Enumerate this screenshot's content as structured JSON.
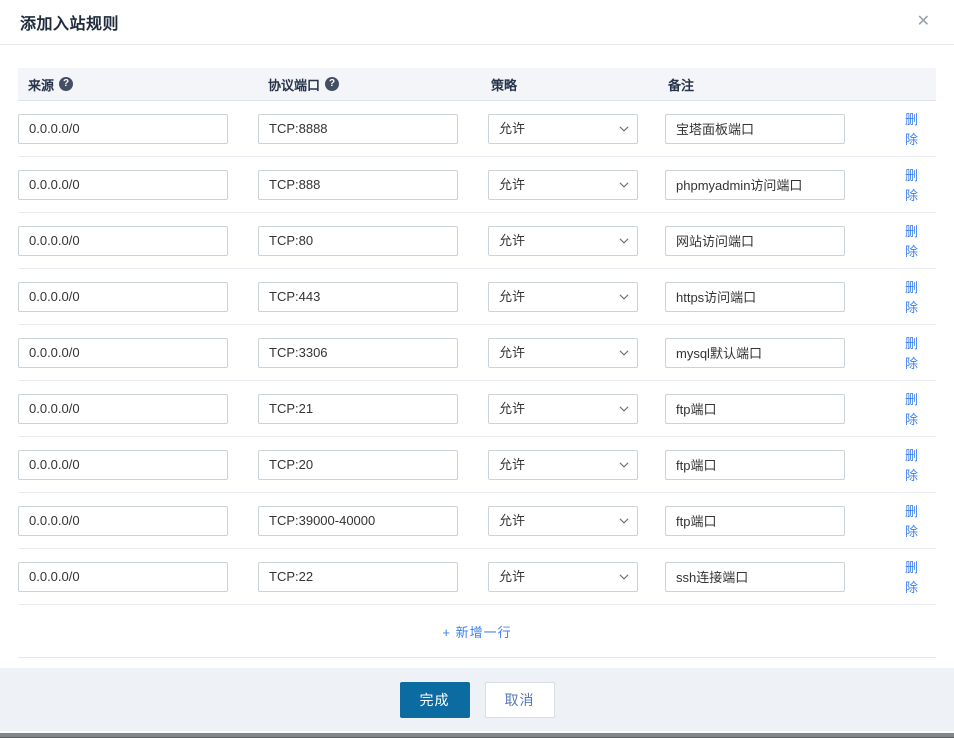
{
  "dialog": {
    "title": "添加入站规则",
    "close_glyph": "✕"
  },
  "icons": {
    "help_glyph": "?"
  },
  "table": {
    "headers": [
      {
        "label": "来源",
        "help": true
      },
      {
        "label": "协议端口",
        "help": true
      },
      {
        "label": "策略",
        "help": false
      },
      {
        "label": "备注",
        "help": false
      }
    ],
    "rows": [
      {
        "source": "0.0.0.0/0",
        "protocol": "TCP:8888",
        "policy": "允许",
        "remark": "宝塔面板端口",
        "action": "删除"
      },
      {
        "source": "0.0.0.0/0",
        "protocol": "TCP:888",
        "policy": "允许",
        "remark": "phpmyadmin访问端口",
        "action": "删除"
      },
      {
        "source": "0.0.0.0/0",
        "protocol": "TCP:80",
        "policy": "允许",
        "remark": "网站访问端口",
        "action": "删除"
      },
      {
        "source": "0.0.0.0/0",
        "protocol": "TCP:443",
        "policy": "允许",
        "remark": "https访问端口",
        "action": "删除"
      },
      {
        "source": "0.0.0.0/0",
        "protocol": "TCP:3306",
        "policy": "允许",
        "remark": "mysql默认端口",
        "action": "删除"
      },
      {
        "source": "0.0.0.0/0",
        "protocol": "TCP:21",
        "policy": "允许",
        "remark": "ftp端口",
        "action": "删除"
      },
      {
        "source": "0.0.0.0/0",
        "protocol": "TCP:20",
        "policy": "允许",
        "remark": "ftp端口",
        "action": "删除"
      },
      {
        "source": "0.0.0.0/0",
        "protocol": "TCP:39000-40000",
        "policy": "允许",
        "remark": "ftp端口",
        "action": "删除"
      },
      {
        "source": "0.0.0.0/0",
        "protocol": "TCP:22",
        "policy": "允许",
        "remark": "ssh连接端口",
        "action": "删除"
      }
    ],
    "add_row_label": "+ 新增一行"
  },
  "footer": {
    "confirm_label": "完成",
    "cancel_label": "取消"
  },
  "colors": {
    "primary_button": "#0c6ba1",
    "link_blue": "#3d7ff0",
    "header_band": "#f3f5f8",
    "footer_band": "#eef1f5"
  }
}
